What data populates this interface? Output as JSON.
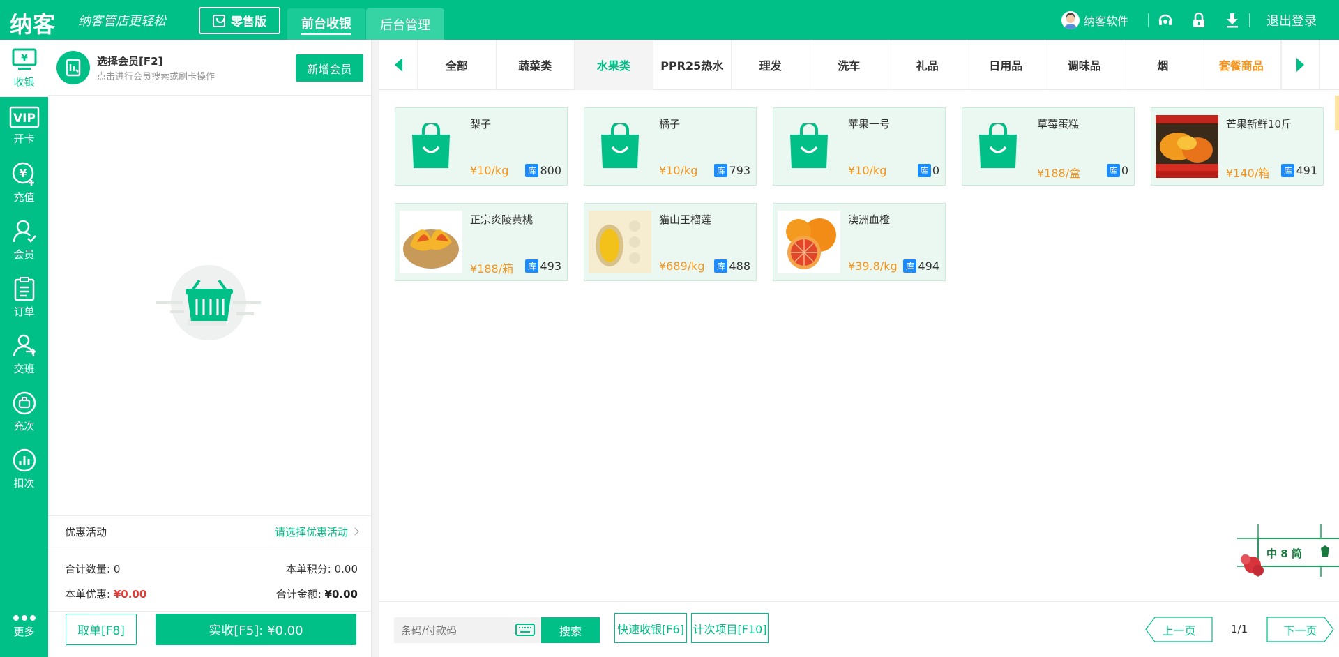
{
  "header": {
    "logo": "纳客",
    "slogan": "纳客管店更轻松",
    "edition": "零售版",
    "tabs": [
      {
        "label": "前台收银"
      },
      {
        "label": "后台管理"
      }
    ],
    "user_name": "纳客软件",
    "logout": "退出登录"
  },
  "sidebar": {
    "items": [
      {
        "label": "收银",
        "icon": "cashier-icon"
      },
      {
        "label": "开卡",
        "icon": "vip-card-icon"
      },
      {
        "label": "充值",
        "icon": "recharge-icon"
      },
      {
        "label": "会员",
        "icon": "member-icon"
      },
      {
        "label": "订单",
        "icon": "order-icon"
      },
      {
        "label": "交班",
        "icon": "shift-icon"
      },
      {
        "label": "充次",
        "icon": "recharge-count-icon"
      },
      {
        "label": "扣次",
        "icon": "deduct-count-icon"
      },
      {
        "label": "更多",
        "icon": "more-icon"
      }
    ]
  },
  "cart": {
    "member_title": "选择会员[F2]",
    "member_hint": "点击进行会员搜索或刷卡操作",
    "add_member": "新增会员",
    "promo_label": "优惠活动",
    "promo_link": "请选择优惠活动",
    "total_qty_label": "合计数量:",
    "total_qty": "0",
    "points_label": "本单积分:",
    "points": "0.00",
    "discount_label": "本单优惠:",
    "discount": "¥0.00",
    "total_label": "合计金额:",
    "total": "¥0.00",
    "cancel_btn": "取单[F8]",
    "pay_btn": "实收[F5]: ¥0.00"
  },
  "categories": [
    {
      "label": "全部"
    },
    {
      "label": "蔬菜类"
    },
    {
      "label": "水果类",
      "active": true
    },
    {
      "label": "PPR25热水"
    },
    {
      "label": "理发"
    },
    {
      "label": "洗车"
    },
    {
      "label": "礼品"
    },
    {
      "label": "日用品"
    },
    {
      "label": "调味品"
    },
    {
      "label": "烟"
    },
    {
      "label": "套餐商品",
      "accent": "#f5931a"
    }
  ],
  "products": [
    {
      "name": "梨子",
      "price": "¥10/kg",
      "stock_tag": "库",
      "stock": "800",
      "image": "bag-icon"
    },
    {
      "name": "橘子",
      "price": "¥10/kg",
      "stock_tag": "库",
      "stock": "793",
      "image": "bag-icon"
    },
    {
      "name": "苹果一号",
      "price": "¥10/kg",
      "stock_tag": "库",
      "stock": "0",
      "image": "bag-icon"
    },
    {
      "name": "草莓蛋糕",
      "price": "¥188/盒",
      "stock_tag": "库",
      "stock": "0",
      "image": "bag-icon"
    },
    {
      "name": "芒果新鲜10斤",
      "price": "¥140/箱",
      "stock_tag": "库",
      "stock": "491",
      "image": "mango-photo"
    },
    {
      "name": "正宗炎陵黄桃",
      "price": "¥188/箱",
      "stock_tag": "库",
      "stock": "493",
      "image": "peach-photo"
    },
    {
      "name": "猫山王榴莲",
      "price": "¥689/kg",
      "stock_tag": "库",
      "stock": "488",
      "image": "durian-photo"
    },
    {
      "name": "澳洲血橙",
      "price": "¥39.8/kg",
      "stock_tag": "库",
      "stock": "494",
      "image": "orange-photo"
    }
  ],
  "footer": {
    "search_placeholder": "条码/付款码",
    "search_btn": "搜索",
    "quick_pay": "快速收银[F6]",
    "count_items": "计次项目[F10]",
    "prev": "上一页",
    "page_info": "1/1",
    "next": "下一页"
  },
  "ime": {
    "label": "中 8 简"
  },
  "colors": {
    "brand": "#00bf87",
    "price": "#f5931a",
    "stock_tag": "#1a8cff",
    "discount": "#e53935"
  }
}
